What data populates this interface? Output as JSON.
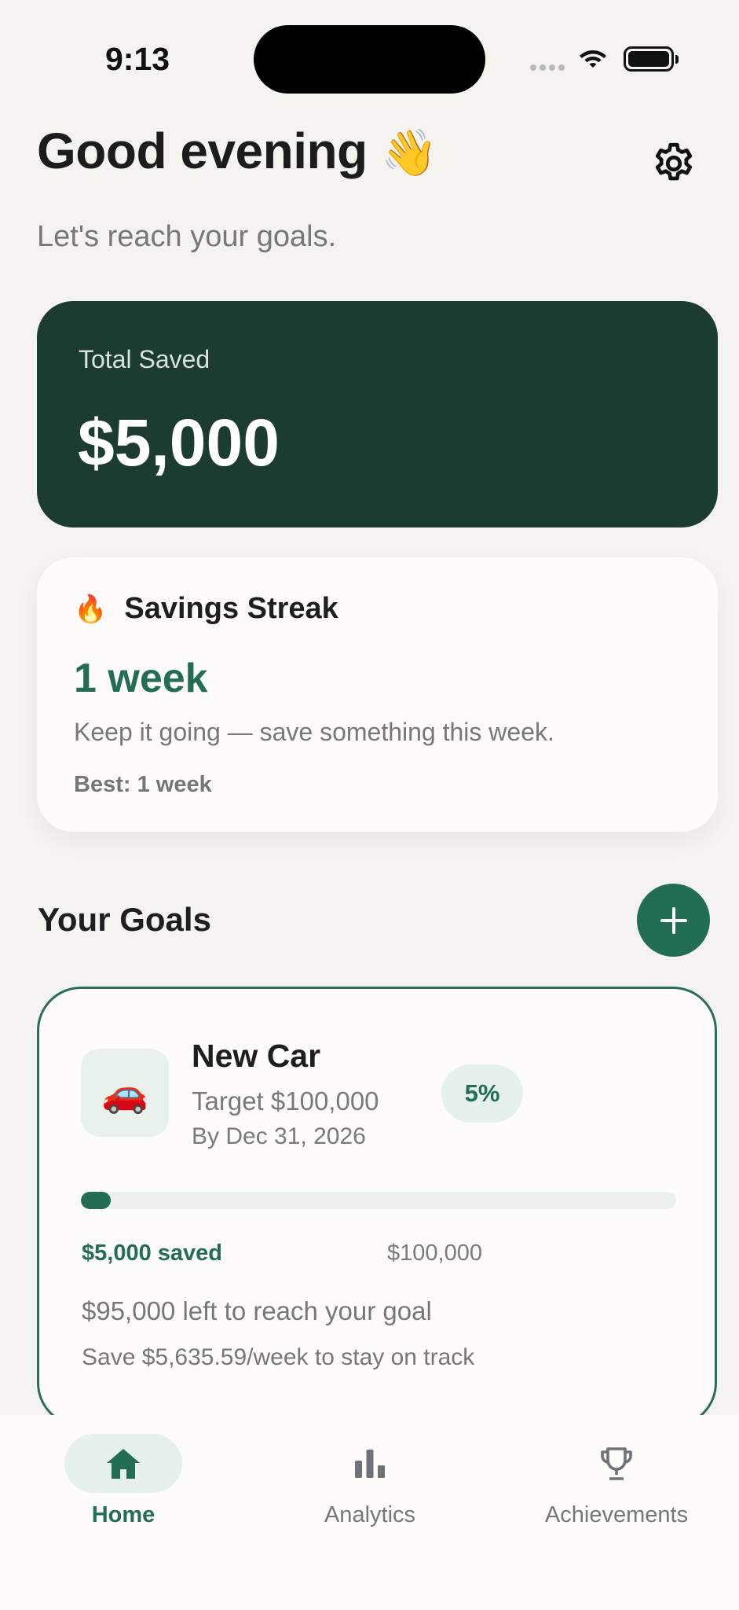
{
  "status_bar": {
    "time": "9:13"
  },
  "header": {
    "greeting": "Good evening",
    "wave_emoji": "👋",
    "subtitle": "Let's reach your goals.",
    "settings_icon": "gear-icon"
  },
  "total_card": {
    "label": "Total Saved",
    "value": "$5,000"
  },
  "streak": {
    "emoji": "🔥",
    "title": "Savings Streak",
    "value": "1 week",
    "message": "Keep it going — save something this week.",
    "best": "Best: 1 week"
  },
  "goals_section": {
    "title": "Your Goals",
    "add_icon": "plus-icon"
  },
  "goal": {
    "emoji": "🚗",
    "name": "New Car",
    "target": "Target $100,000",
    "date": "By Dec 31, 2026",
    "percent": "5%",
    "progress_fraction": 0.05,
    "saved": "$5,000 saved",
    "target_amount": "$100,000",
    "remaining": "$95,000 left to reach your goal",
    "pace": "Save $5,635.59/week to stay on track"
  },
  "tabs": [
    {
      "label": "Home",
      "icon": "home-icon",
      "active": true
    },
    {
      "label": "Analytics",
      "icon": "bar-chart-icon",
      "active": false
    },
    {
      "label": "Achievements",
      "icon": "trophy-icon",
      "active": false
    }
  ],
  "colors": {
    "accent": "#236e50",
    "dark_card": "#1c3c2f",
    "background": "#f4f3f0"
  }
}
